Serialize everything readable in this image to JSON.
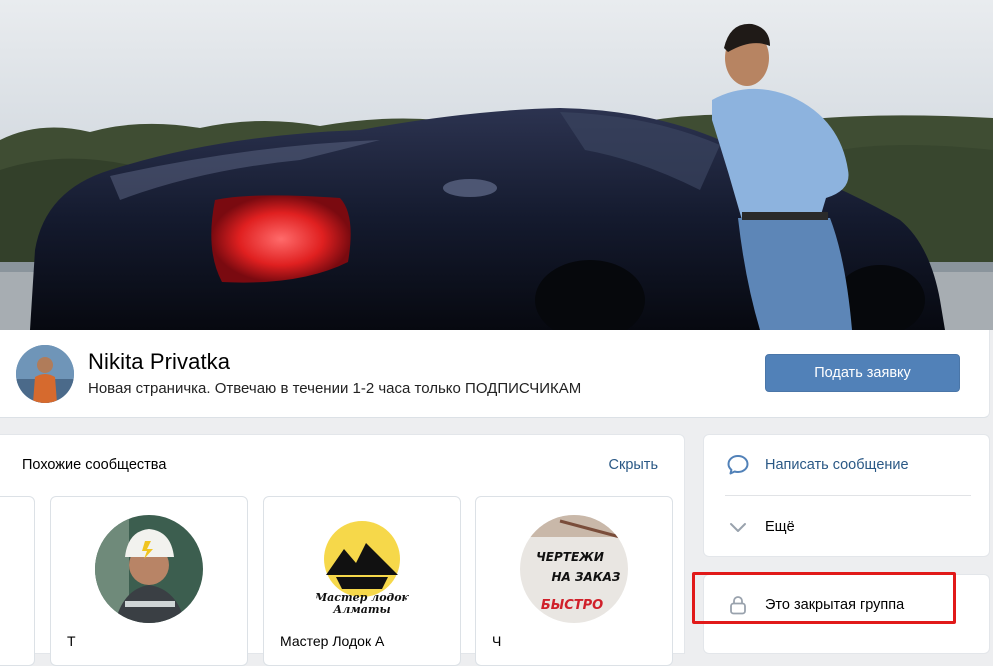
{
  "group": {
    "name": "Nikita Privatka",
    "status": "Новая страничка. Отвечаю в течении 1-2 часа только ПОДПИСЧИКАМ",
    "apply_button": "Подать заявку"
  },
  "similar": {
    "title": "Похожие сообщества",
    "hide_label": "Скрыть",
    "items": [
      {
        "name": "Т",
        "icon": "worker-helmet-avatar"
      },
      {
        "name": "Мастер Лодок А",
        "logo_text_1": "Мастер лодок",
        "logo_text_2": "Алматы",
        "icon": "boat-master-logo"
      },
      {
        "name": "Ч",
        "logo_text_1": "ЧЕРТЕЖИ",
        "logo_text_2": "НА ЗАКАЗ",
        "logo_text_3": "БЫСТРО",
        "icon": "blueprints-logo"
      }
    ]
  },
  "actions": {
    "message": "Написать сообщение",
    "more": "Ещё",
    "closed_group": "Это закрытая группа"
  },
  "colors": {
    "accent": "#5181b8",
    "link": "#2a5885",
    "highlight": "#e11919"
  }
}
